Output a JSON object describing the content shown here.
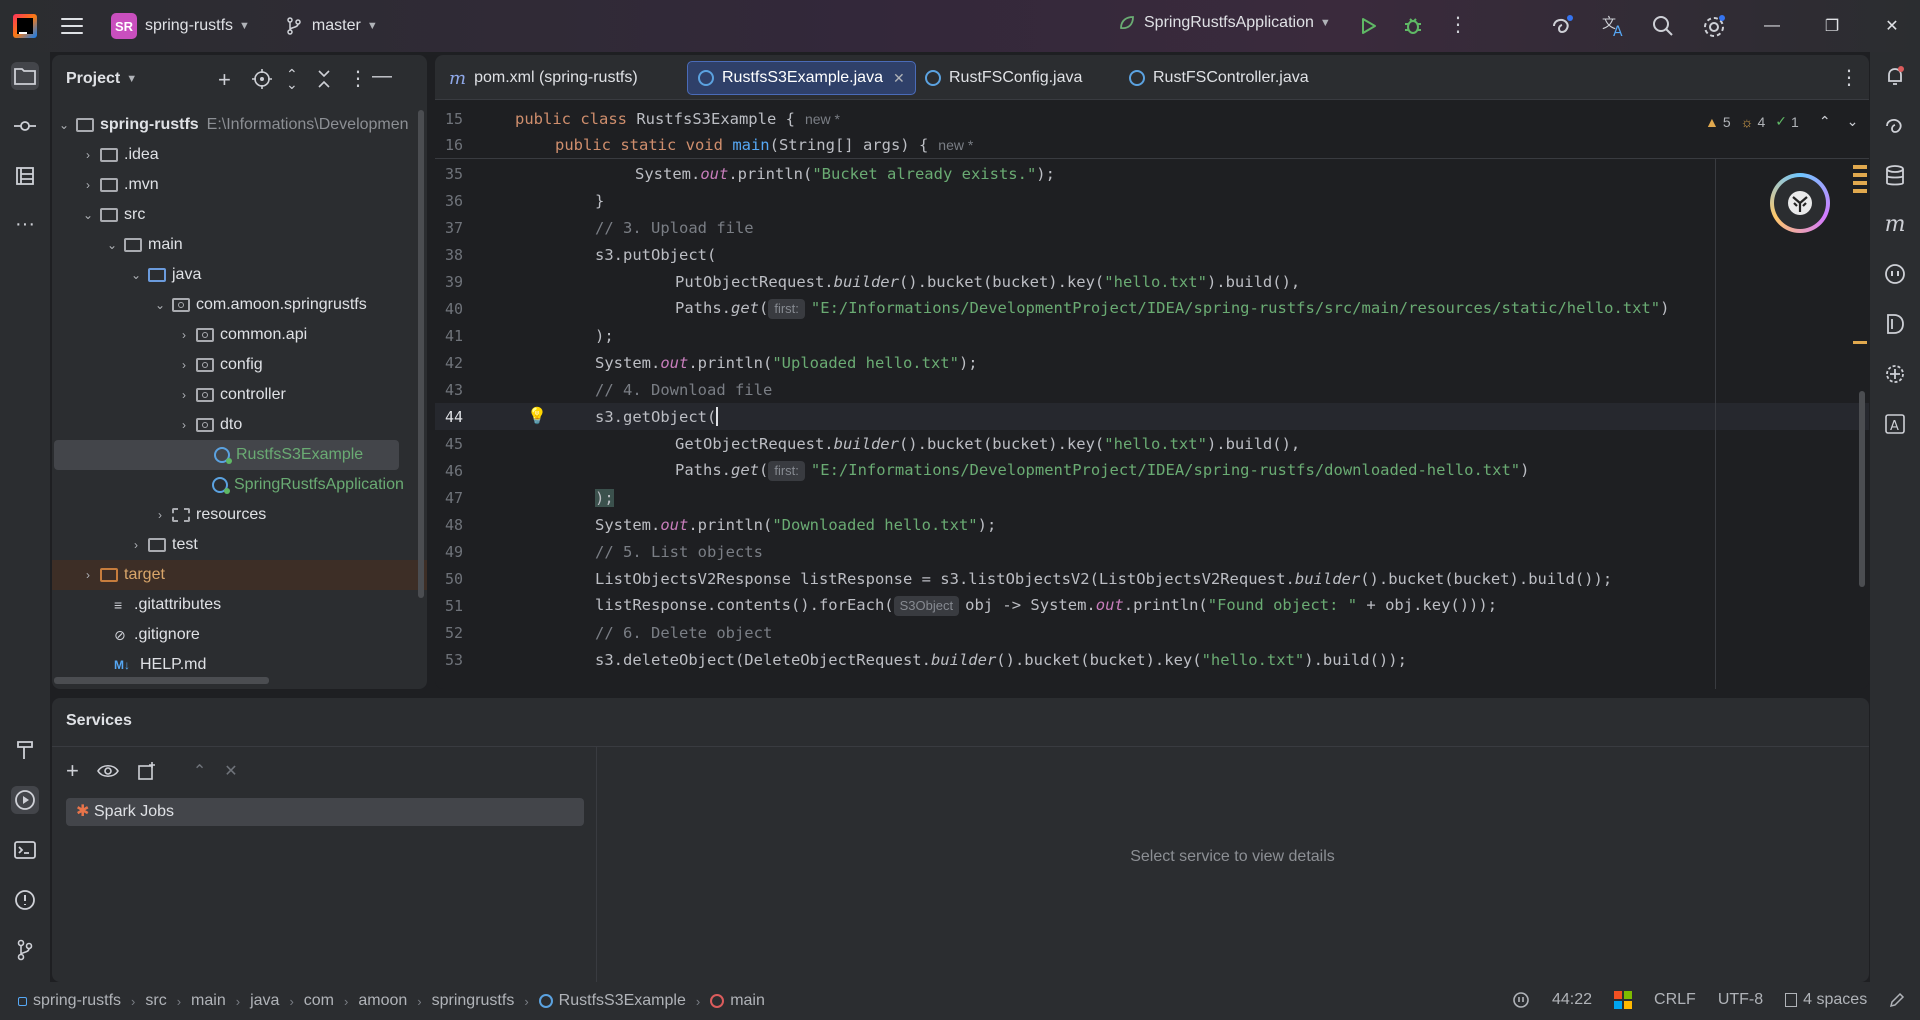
{
  "titlebar": {
    "project_badge": "SR",
    "project_name": "spring-rustfs",
    "branch": "master",
    "run_config": "SpringRustfsApplication"
  },
  "project_panel": {
    "title": "Project",
    "tree": [
      {
        "label": "spring-rustfs",
        "path": "E:\\Informations\\Developmen",
        "type": "module"
      },
      {
        "label": ".idea",
        "type": "folder"
      },
      {
        "label": ".mvn",
        "type": "folder"
      },
      {
        "label": "src",
        "type": "folder"
      },
      {
        "label": "main",
        "type": "folder"
      },
      {
        "label": "java",
        "type": "folder"
      },
      {
        "label": "com.amoon.springrustfs",
        "type": "package"
      },
      {
        "label": "common.api",
        "type": "package"
      },
      {
        "label": "config",
        "type": "package"
      },
      {
        "label": "controller",
        "type": "package"
      },
      {
        "label": "dto",
        "type": "package"
      },
      {
        "label": "RustfsS3Example",
        "type": "class"
      },
      {
        "label": "SpringRustfsApplication",
        "type": "class"
      },
      {
        "label": "resources",
        "type": "folder"
      },
      {
        "label": "test",
        "type": "folder"
      },
      {
        "label": "target",
        "type": "folder"
      },
      {
        "label": ".gitattributes",
        "type": "file"
      },
      {
        "label": ".gitignore",
        "type": "file"
      },
      {
        "label": "HELP.md",
        "type": "file"
      }
    ]
  },
  "editor": {
    "tabs": [
      {
        "label": "pom.xml (spring-rustfs)"
      },
      {
        "label": "RustfsS3Example.java"
      },
      {
        "label": "RustFSConfig.java"
      },
      {
        "label": "RustFSController.java"
      }
    ],
    "inspections": {
      "warnings": "5",
      "weak": "4",
      "ok": "1"
    },
    "sticky": [
      {
        "num": "15",
        "code": "public class RustfsS3Example {",
        "tag": "new *"
      },
      {
        "num": "16",
        "code": "public static void main(String[] args) {",
        "tag": "new *"
      }
    ],
    "hint_first": "first:",
    "hint_type": "S3Object",
    "lines": {
      "l35": {
        "num": "35",
        "a": "System.",
        "b": "out",
        "c": ".println(",
        "s": "\"Bucket already exists.\"",
        "d": ");"
      },
      "l36": {
        "num": "36",
        "code": "}"
      },
      "l37": {
        "num": "37",
        "code": "// 3. Upload file"
      },
      "l38": {
        "num": "38",
        "code": "s3.putObject("
      },
      "l39": {
        "num": "39",
        "a": "PutObjectRequest.",
        "b": "builder",
        "c": "().bucket(bucket).key(",
        "s": "\"hello.txt\"",
        "d": ").build(),"
      },
      "l40": {
        "num": "40",
        "a": "Paths.",
        "b": "get",
        "c": "(",
        "s": "\"E:/Informations/DevelopmentProject/IDEA/spring-rustfs/src/main/resources/static/hello.txt\"",
        "d": ")"
      },
      "l41": {
        "num": "41",
        "code": ");"
      },
      "l42": {
        "num": "42",
        "a": "System.",
        "b": "out",
        "c": ".println(",
        "s": "\"Uploaded hello.txt\"",
        "d": ");"
      },
      "l43": {
        "num": "43",
        "code": "// 4. Download file"
      },
      "l44": {
        "num": "44",
        "code": "s3.getObject("
      },
      "l45": {
        "num": "45",
        "a": "GetObjectRequest.",
        "b": "builder",
        "c": "().bucket(bucket).key(",
        "s": "\"hello.txt\"",
        "d": ").build(),"
      },
      "l46": {
        "num": "46",
        "a": "Paths.",
        "b": "get",
        "c": "(",
        "s": "\"E:/Informations/DevelopmentProject/IDEA/spring-rustfs/downloaded-hello.txt\"",
        "d": ")"
      },
      "l47": {
        "num": "47",
        "code": ");"
      },
      "l48": {
        "num": "48",
        "a": "System.",
        "b": "out",
        "c": ".println(",
        "s": "\"Downloaded hello.txt\"",
        "d": ");"
      },
      "l49": {
        "num": "49",
        "code": "// 5. List objects"
      },
      "l50": {
        "num": "50",
        "a": "ListObjectsV2Response listResponse = s3.listObjectsV2(ListObjectsV2Request.",
        "b": "builder",
        "c": "().bucket(bucket).build());"
      },
      "l51": {
        "num": "51",
        "a": "listResponse.contents().forEach(",
        "c": "obj -> System.",
        "b": "out",
        "d": ".println(",
        "s": "\"Found object: \"",
        "e": " + obj.key()));"
      },
      "l52": {
        "num": "52",
        "code": "// 6. Delete object"
      },
      "l53": {
        "num": "53",
        "a": "s3.deleteObject(DeleteObjectRequest.",
        "b": "builder",
        "c": "().bucket(bucket).key(",
        "s": "\"hello.txt\"",
        "d": ").build());"
      }
    }
  },
  "services": {
    "title": "Services",
    "items": [
      {
        "label": "Spark Jobs"
      }
    ],
    "empty_text": "Select service to view details"
  },
  "statusbar": {
    "breadcrumbs": [
      "spring-rustfs",
      "src",
      "main",
      "java",
      "com",
      "amoon",
      "springrustfs",
      "RustfsS3Example",
      "main"
    ],
    "position": "44:22",
    "line_sep": "CRLF",
    "encoding": "UTF-8",
    "indent": "4 spaces"
  },
  "colors": {
    "accent": "#3574f0",
    "selection": "#2f4069",
    "string": "#6aab73",
    "keyword": "#cf8e6d"
  }
}
